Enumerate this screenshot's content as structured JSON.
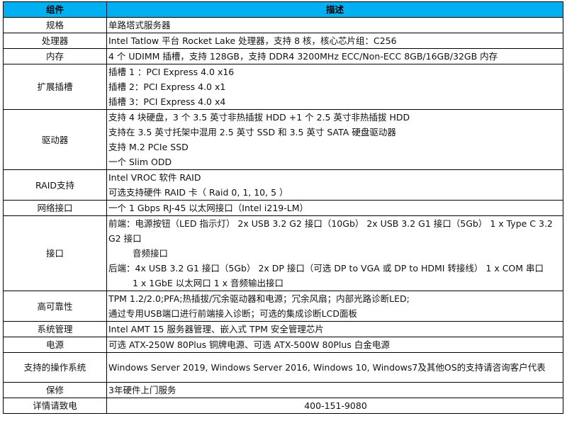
{
  "table": {
    "header": {
      "component": "组件",
      "description": "描述"
    },
    "rows": {
      "spec": {
        "label": "规格",
        "lines": [
          "单路塔式服务器"
        ]
      },
      "cpu": {
        "label": "处理器",
        "lines": [
          " Intel Tatlow 平台 Rocket Lake 处理器，支持 8 核，核心芯片组：C256"
        ]
      },
      "memory": {
        "label": "内存",
        "lines": [
          "4 个 UDIMM 插槽，支持 128GB，支持 DDR4 3200MHz ECC/Non-ECC 8GB/16GB/32GB 内存"
        ]
      },
      "expansion": {
        "label": "扩展插槽",
        "lines": [
          "插槽 1 ：PCI Express 4.0 x16",
          "插槽 2：PCI Express 4.0 x1",
          "插槽 3：PCI Express 4.0 x4"
        ]
      },
      "drives": {
        "label": "驱动器",
        "lines": [
          "支持 4 块硬盘，3 个 3.5 英寸非热插拔 HDD +1 个 2.5 英寸非热插拔 HDD",
          "支持在 3.5 英寸托架中混用 2.5 英寸 SSD 和 3.5 英寸 SATA 硬盘驱动器",
          "支持 M.2 PCIe SSD",
          "一个 Slim ODD"
        ]
      },
      "raid": {
        "label": "RAID支持",
        "lines": [
          "Intel VROC 软件 RAID",
          "可选支持硬件 RAID 卡（ Raid 0, 1, 10, 5 ）"
        ]
      },
      "network": {
        "label": "网络接口",
        "lines": [
          "一个 1 Gbps RJ-45 以太网接口（Intel i219-LM）"
        ]
      },
      "ports": {
        "label": "接口",
        "front": "前端：电源按钮（LED 指示灯） 2x USB 3.2 G2 接口（10Gb） 2x USB 3.2 G1 接口（5Gb） 1 x Type C 3.2 G2 接口",
        "front_audio": "音频接口",
        "rear": "后端：4x USB 3.2 G1 接口（5Gb） 2x DP 接口（可选 DP to VGA 或 DP to HDMI 转接线） 1 x COM 串口",
        "rear_cont": "1 x 1GbE 以太网口 1 x 音频输出接口"
      },
      "ha": {
        "label": "高可靠性",
        "lines": [
          "TPM 1.2/2.0;PFA;热插拔/冗余驱动器和电源；冗余风扇；内部光路诊断LED;",
          "通过专用USB端口进行前端接入诊断；可选的集成诊断LCD面板"
        ]
      },
      "mgmt": {
        "label": "系统管理",
        "lines": [
          "Intel AMT 15 服务器管理、嵌入式 TPM 安全管理芯片"
        ]
      },
      "power": {
        "label": "电源",
        "lines": [
          "可选 ATX-250W 80Plus 铜牌电源、可选 ATX-500W 80Plus 白金电源"
        ]
      },
      "os": {
        "label": "支持的操作系统",
        "lines": [
          "Windows Server 2019, Windows Server 2016, Windows 10, Windows7及其他OS的支持请咨询客户代表"
        ]
      },
      "warranty": {
        "label": "保修",
        "lines": [
          "3年硬件上门服务"
        ]
      },
      "contact": {
        "label": "详情请致电",
        "lines": [
          "400-151-9080"
        ]
      }
    }
  },
  "colors": {
    "header_bg": "#00b0f0",
    "border": "#000000"
  }
}
